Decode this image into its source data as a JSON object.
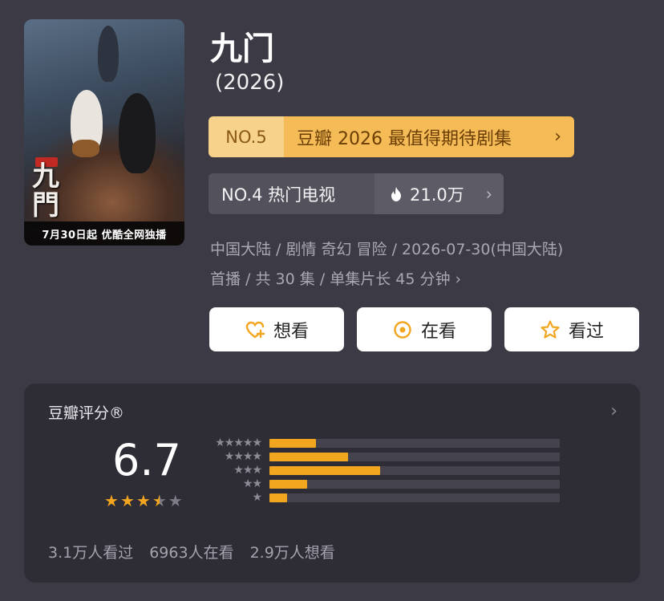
{
  "poster": {
    "caption": "7月30日起 优酷全网独播"
  },
  "show": {
    "title": "九门",
    "year": "(2026)"
  },
  "ranks": {
    "gold": {
      "no": "NO.5",
      "text": "豆瓣 2026 最值得期待剧集",
      "chevron": "›"
    },
    "hot": {
      "label": "NO.4 热门电视",
      "heat": "21.0万",
      "chevron": "›"
    }
  },
  "meta": {
    "line1": "中国大陆 / 剧情 奇幻 冒险 / 2026-07-30(中国大陆)",
    "line2": "首播 / 共 30 集 / 单集片长 45 分钟",
    "chevron": "›"
  },
  "actions": [
    {
      "label": "想看",
      "icon": "heart-plus-icon"
    },
    {
      "label": "在看",
      "icon": "target-icon"
    },
    {
      "label": "看过",
      "icon": "star-icon"
    }
  ],
  "rating": {
    "title": "豆瓣评分®",
    "chevron": "›",
    "score": "6.7",
    "stars": 3.5,
    "distribution": [
      {
        "stars": "★★★★★",
        "fraction": 0.16
      },
      {
        "stars": "★★★★",
        "fraction": 0.27
      },
      {
        "stars": "★★★",
        "fraction": 0.38
      },
      {
        "stars": "★★",
        "fraction": 0.13
      },
      {
        "stars": "★",
        "fraction": 0.06
      }
    ],
    "stats": [
      "3.1万人看过",
      "6963人在看",
      "2.9万人想看"
    ]
  },
  "colors": {
    "background": "#3b3a45",
    "card": "#2e2d36",
    "accent": "#f2a51e",
    "gold_badge": "#f4bb56"
  }
}
